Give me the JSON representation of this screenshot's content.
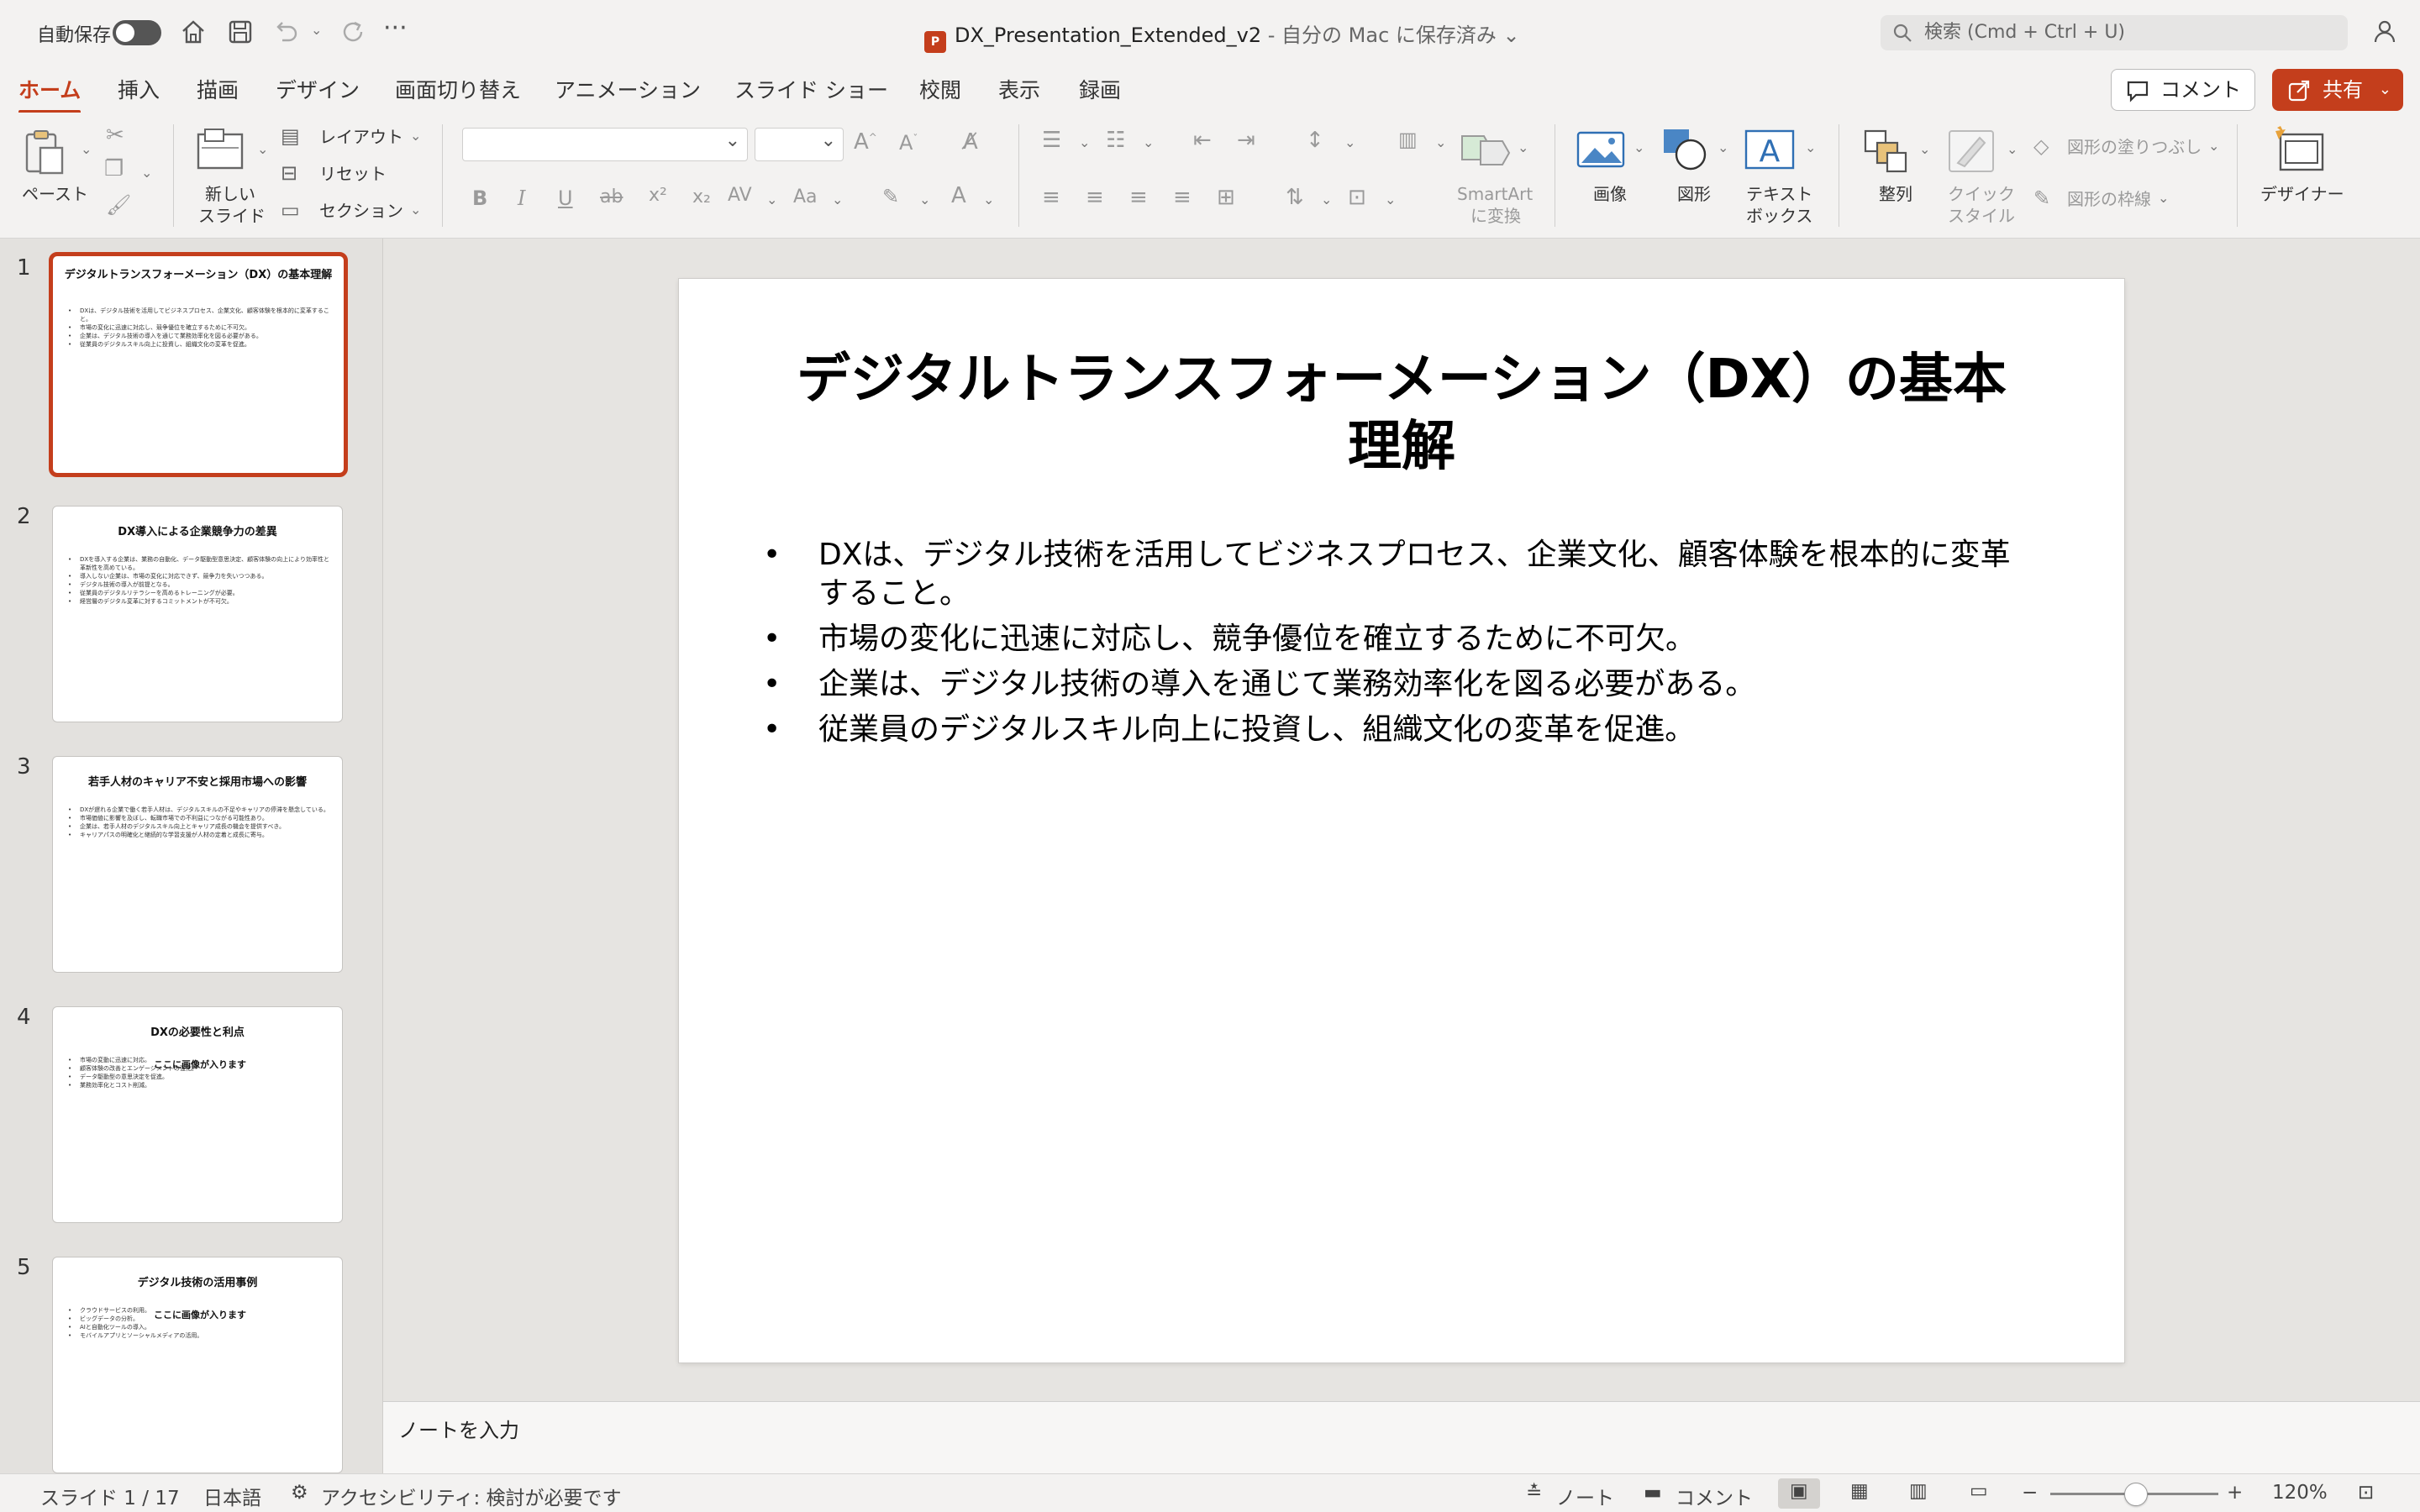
{
  "titlebar": {
    "autosave_label": "自動保存",
    "doc_name": "DX_Presentation_Extended_v2",
    "doc_location": " - 自分の Mac に保存済み",
    "search_placeholder": "検索 (Cmd + Ctrl + U)"
  },
  "tabs": [
    {
      "label": "ホーム",
      "active": true
    },
    {
      "label": "挿入"
    },
    {
      "label": "描画"
    },
    {
      "label": "デザイン"
    },
    {
      "label": "画面切り替え"
    },
    {
      "label": "アニメーション"
    },
    {
      "label": "スライド ショー"
    },
    {
      "label": "校閲"
    },
    {
      "label": "表示"
    },
    {
      "label": "録画"
    }
  ],
  "actions": {
    "comment": "コメント",
    "share": "共有"
  },
  "ribbon": {
    "paste": "ペースト",
    "new_slide_1": "新しい",
    "new_slide_2": "スライド",
    "layout": "レイアウト",
    "reset": "リセット",
    "section": "セクション",
    "smartart_1": "SmartArt",
    "smartart_2": "に変換",
    "image": "画像",
    "shapes": "図形",
    "textbox_1": "テキスト",
    "textbox_2": "ボックス",
    "arrange": "整列",
    "quick_style_1": "クイック",
    "quick_style_2": "スタイル",
    "shape_fill": "図形の塗りつぶし",
    "shape_outline": "図形の枠線",
    "designer": "デザイナー"
  },
  "thumbnails": [
    {
      "num": "1",
      "title": "デジタルトランスフォーメーション（DX）の基本理解",
      "bullets": [
        "DXは、デジタル技術を活用してビジネスプロセス、企業文化、顧客体験を根本的に変革すること。",
        "市場の変化に迅速に対応し、競争優位を確立するために不可欠。",
        "企業は、デジタル技術の導入を通じて業務効率化を図る必要がある。",
        "従業員のデジタルスキル向上に投資し、組織文化の変革を促進。"
      ]
    },
    {
      "num": "2",
      "title": "DX導入による企業競争力の差異",
      "bullets": [
        "DXを導入する企業は、業務の自動化、データ駆動型意思決定、顧客体験の向上により効率性と革新性を高めている。",
        "導入しない企業は、市場の変化に対応できず、競争力を失いつつある。",
        "デジタル技術の導入が前提となる。",
        "従業員のデジタルリテラシーを高めるトレーニングが必要。",
        "経営層のデジタル変革に対するコミットメントが不可欠。"
      ]
    },
    {
      "num": "3",
      "title": "若手人材のキャリア不安と採用市場への影響",
      "bullets": [
        "DXが遅れる企業で働く若手人材は、デジタルスキルの不足やキャリアの停滞を懸念している。",
        "市場価値に影響を及ぼし、転職市場での不利益につながる可能性あり。",
        "企業は、若手人材のデジタルスキル向上とキャリア成長の機会を提供すべき。",
        "キャリアパスの明確化と継続的な学習支援が人材の定着と成長に寄与。"
      ]
    },
    {
      "num": "4",
      "title": "DXの必要性と利点",
      "image_text": "ここに画像が入ります",
      "bullets": [
        "市場の変動に迅速に対応。",
        "顧客体験の改善とエンゲージメントの強化。",
        "データ駆動型の意思決定を促進。",
        "業務効率化とコスト削減。"
      ]
    },
    {
      "num": "5",
      "title": "デジタル技術の活用事例",
      "image_text": "ここに画像が入ります",
      "bullets": [
        "クラウドサービスの利用。",
        "ビッグデータの分析。",
        "AIと自動化ツールの導入。",
        "モバイルアプリとソーシャルメディアの活用。"
      ]
    }
  ],
  "slide": {
    "title_line1": "デジタルトランスフォーメーション（DX）の基本",
    "title_line2": "理解",
    "bullets": [
      "DXは、デジタル技術を活用してビジネスプロセス、企業文化、顧客体験を根本的に変革すること。",
      "市場の変化に迅速に対応し、競争優位を確立するために不可欠。",
      "企業は、デジタル技術の導入を通じて業務効率化を図る必要がある。",
      "従業員のデジタルスキル向上に投資し、組織文化の変革を促進。"
    ]
  },
  "notes_placeholder": "ノートを入力",
  "status": {
    "slide_counter": "スライド 1 / 17",
    "language": "日本語",
    "accessibility": "アクセシビリティ: 検討が必要です",
    "notes": "ノート",
    "comments": "コメント",
    "zoom": "120%"
  },
  "colors": {
    "accent": "#c43e1c"
  }
}
